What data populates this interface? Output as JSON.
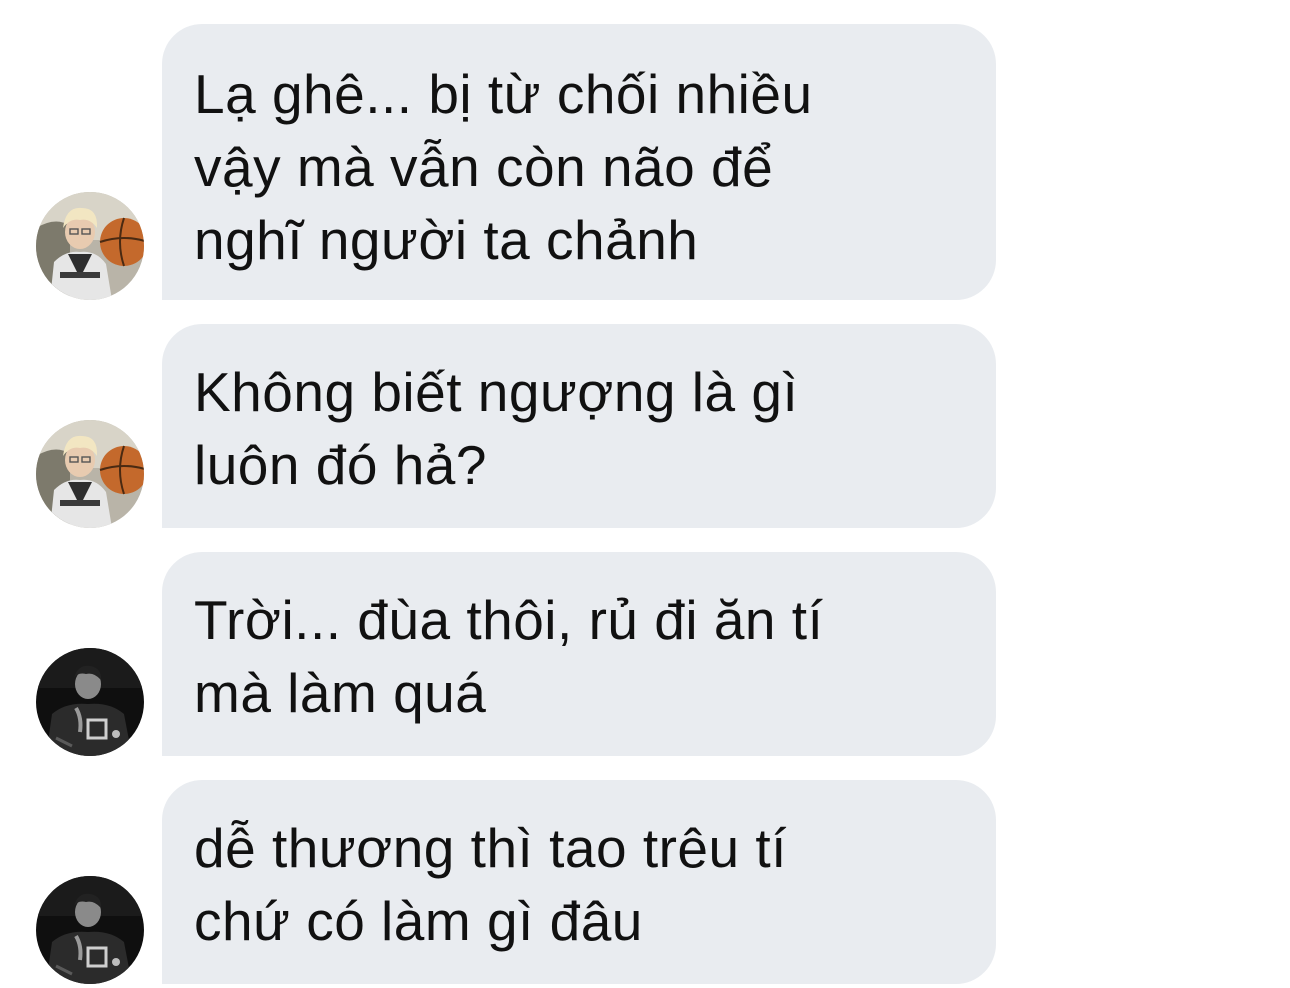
{
  "thread": {
    "messages": [
      {
        "text": "Lạ ghê... bị từ chối nhiều\nvậy mà vẫn còn não để\nnghĩ người ta chảnh",
        "avatar_icon": "avatar-blonde-basketball"
      },
      {
        "text": "Không biết ngượng là gì\nluôn đó hả?",
        "avatar_icon": "avatar-blonde-basketball"
      },
      {
        "text": "Trời... đùa thôi, rủ đi ăn tí\nmà làm quá",
        "avatar_icon": "avatar-dark-jersey"
      },
      {
        "text": "dễ thương thì tao trêu tí\nchứ có làm gì đâu",
        "avatar_icon": "avatar-dark-jersey"
      }
    ]
  },
  "colors": {
    "bubble": "#e9ecf0",
    "text": "#111111",
    "background": "#ffffff"
  }
}
